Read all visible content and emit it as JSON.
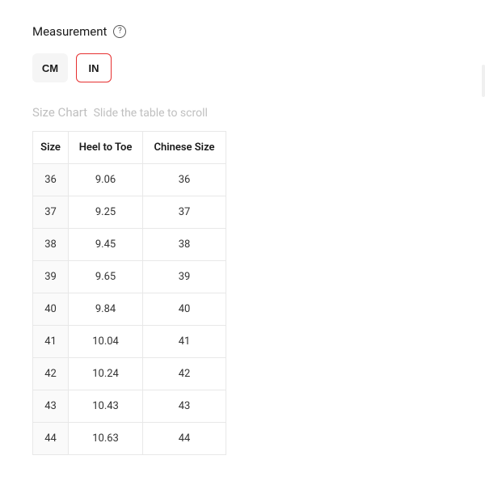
{
  "measurement": {
    "label": "Measurement",
    "help_icon": "?"
  },
  "units": {
    "cm_label": "CM",
    "in_label": "IN",
    "active": "in"
  },
  "size_chart": {
    "title": "Size Chart",
    "hint": "Slide the table to scroll",
    "columns": [
      "Size",
      "Heel to Toe",
      "Chinese Size"
    ],
    "rows": [
      {
        "size": "36",
        "heel_to_toe": "9.06",
        "chinese_size": "36"
      },
      {
        "size": "37",
        "heel_to_toe": "9.25",
        "chinese_size": "37"
      },
      {
        "size": "38",
        "heel_to_toe": "9.45",
        "chinese_size": "38"
      },
      {
        "size": "39",
        "heel_to_toe": "9.65",
        "chinese_size": "39"
      },
      {
        "size": "40",
        "heel_to_toe": "9.84",
        "chinese_size": "40"
      },
      {
        "size": "41",
        "heel_to_toe": "10.04",
        "chinese_size": "41"
      },
      {
        "size": "42",
        "heel_to_toe": "10.24",
        "chinese_size": "42"
      },
      {
        "size": "43",
        "heel_to_toe": "10.43",
        "chinese_size": "43"
      },
      {
        "size": "44",
        "heel_to_toe": "10.63",
        "chinese_size": "44"
      }
    ]
  }
}
